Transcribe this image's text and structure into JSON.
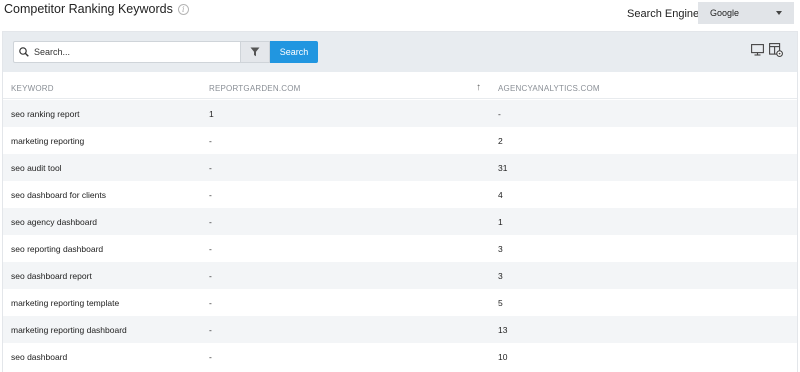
{
  "header": {
    "title": "Competitor Ranking Keywords",
    "info_icon": "i",
    "search_engine_label": "Search Engine",
    "search_engine_value": "Google"
  },
  "toolbar": {
    "search_placeholder": "Search...",
    "search_button": "Search"
  },
  "table": {
    "columns": [
      "KEYWORD",
      "REPORTGARDEN.COM",
      "AGENCYANALYTICS.COM"
    ],
    "sort_indicator": "↑",
    "rows": [
      {
        "keyword": "seo ranking report",
        "reportgarden": "1",
        "agencyanalytics": "-"
      },
      {
        "keyword": "marketing reporting",
        "reportgarden": "-",
        "agencyanalytics": "2"
      },
      {
        "keyword": "seo audit tool",
        "reportgarden": "-",
        "agencyanalytics": "31"
      },
      {
        "keyword": "seo dashboard for clients",
        "reportgarden": "-",
        "agencyanalytics": "4"
      },
      {
        "keyword": "seo agency dashboard",
        "reportgarden": "-",
        "agencyanalytics": "1"
      },
      {
        "keyword": "seo reporting dashboard",
        "reportgarden": "-",
        "agencyanalytics": "3"
      },
      {
        "keyword": "seo dashboard report",
        "reportgarden": "-",
        "agencyanalytics": "3"
      },
      {
        "keyword": "marketing reporting template",
        "reportgarden": "-",
        "agencyanalytics": "5"
      },
      {
        "keyword": "marketing reporting dashboard",
        "reportgarden": "-",
        "agencyanalytics": "13"
      },
      {
        "keyword": "seo dashboard",
        "reportgarden": "-",
        "agencyanalytics": "10"
      }
    ]
  },
  "colors": {
    "accent": "#2196e0",
    "toolbar_bg": "#e8ecf0",
    "row_alt": "#f3f5f7"
  }
}
